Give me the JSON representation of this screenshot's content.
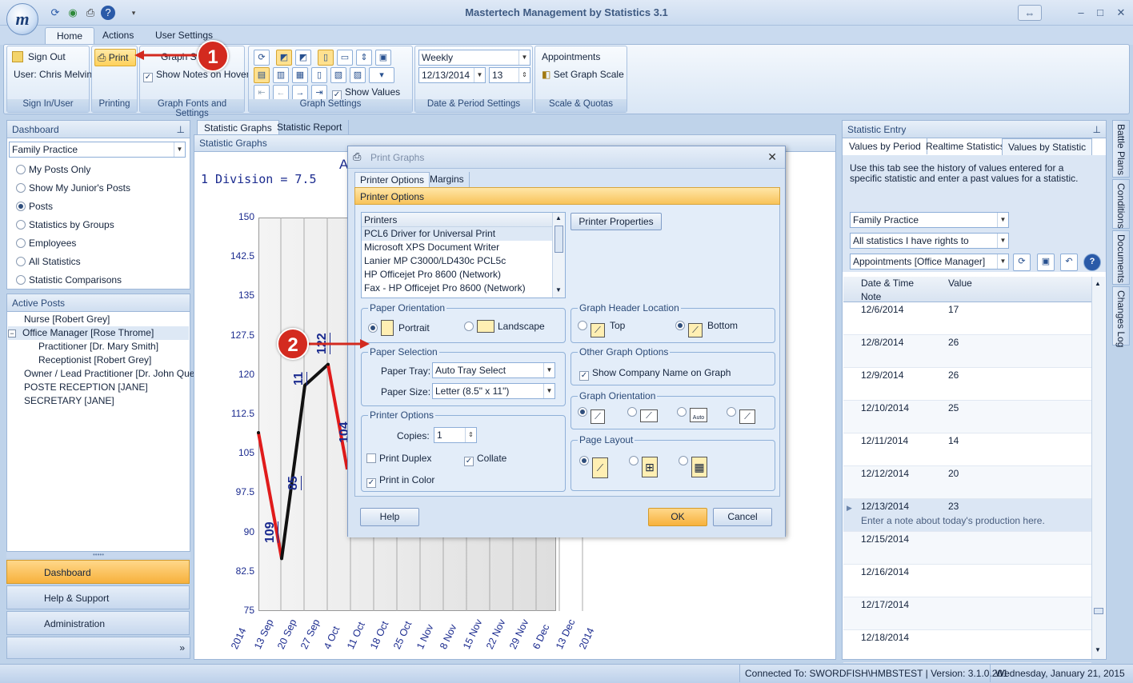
{
  "app": {
    "title": "Mastertech Management by Statistics 3.1",
    "logo": "m"
  },
  "ribbon_tabs": [
    "Home",
    "Actions",
    "User Settings"
  ],
  "ribbon": {
    "signin": {
      "sign_out": "Sign Out",
      "user": "User: Chris Melvin",
      "label": "Sign In/User"
    },
    "printing": {
      "print": "Print",
      "label": "Printing"
    },
    "fonts": {
      "graph_settings": "Graph Se",
      "show_notes": "Show Notes on Hover",
      "label": "Graph Fonts and Settings"
    },
    "graph_settings": {
      "show_values": "Show Values",
      "label": "Graph Settings"
    },
    "date": {
      "period": "Weekly",
      "date": "12/13/2014",
      "count": "13",
      "label": "Date & Period Settings"
    },
    "scale": {
      "appointments": "Appointments",
      "set_scale": "Set Graph Scale",
      "label": "Scale & Quotas"
    }
  },
  "dashboard": {
    "title": "Dashboard",
    "selector": "Family Practice",
    "options": [
      "My Posts Only",
      "Show My Junior's Posts",
      "Posts",
      "Statistics by Groups",
      "Employees",
      "All Statistics",
      "Statistic Comparisons"
    ],
    "selected_option": "Posts",
    "active_posts_title": "Active Posts",
    "posts": [
      "Nurse [Robert Grey]",
      "Office Manager [Rose Throme]",
      "Practitioner  [Dr. Mary Smith]",
      "Receptionist  [Robert Grey]",
      "Owner / Lead Practitioner  [Dr. John Que]",
      "POSTE RECEPTION [JANE]",
      "SECRETARY [JANE]"
    ],
    "nav": [
      "Dashboard",
      "Help & Support",
      "Administration"
    ]
  },
  "center": {
    "tabs": [
      "Statistic Graphs",
      "Statistic Report"
    ],
    "header": "Statistic Graphs",
    "division": "1 Division = 7.5",
    "title_fragment": "A"
  },
  "chart_data": {
    "type": "line",
    "y_ticks": [
      "150",
      "142.5",
      "135",
      "127.5",
      "120",
      "112.5",
      "105",
      "97.5",
      "90",
      "82.5",
      "75"
    ],
    "ylim": [
      75,
      150
    ],
    "x_ticks": [
      "2014",
      "13 Sep",
      "20 Sep",
      "27 Sep",
      "4 Oct",
      "11 Oct",
      "18 Oct",
      "25 Oct",
      "1 Nov",
      "8 Nov",
      "15 Nov",
      "22 Nov",
      "29 Nov",
      "6 Dec",
      "13 Dec",
      "2014"
    ],
    "series": [
      {
        "values": [
          109,
          85,
          118,
          122,
          104
        ]
      }
    ],
    "value_labels": [
      "109",
      "85",
      "11",
      "122",
      "104"
    ]
  },
  "dialog": {
    "title": "Print Graphs",
    "tabs": [
      "Printer Options",
      "Margins"
    ],
    "section": "Printer Options",
    "printers_header": "Printers",
    "printers": [
      "PCL6 Driver for Universal Print",
      "Microsoft XPS Document Writer",
      "Lanier MP C3000/LD430c PCL5c",
      "HP Officejet Pro 8600 (Network)",
      "Fax - HP Officejet Pro 8600 (Network)"
    ],
    "printer_properties": "Printer Properties",
    "orientation": {
      "label": "Paper Orientation",
      "portrait": "Portrait",
      "landscape": "Landscape"
    },
    "header_location": {
      "label": "Graph Header Location",
      "top": "Top",
      "bottom": "Bottom"
    },
    "paper": {
      "label": "Paper Selection",
      "tray_label": "Paper Tray:",
      "tray": "Auto Tray Select",
      "size_label": "Paper Size:",
      "size": "Letter (8.5\" x 11\")"
    },
    "other": {
      "label": "Other Graph Options",
      "company": "Show Company Name on Graph"
    },
    "graph_orientation": {
      "label": "Graph Orientation",
      "auto": "Auto"
    },
    "printer_options": {
      "label": "Printer Options",
      "copies_label": "Copies:",
      "copies": "1",
      "duplex": "Print Duplex",
      "collate": "Collate",
      "color": "Print in Color"
    },
    "page_layout": {
      "label": "Page Layout"
    },
    "help": "Help",
    "ok": "OK",
    "cancel": "Cancel"
  },
  "stat_entry": {
    "title": "Statistic Entry",
    "tabs": [
      "Values by Period",
      "Realtime Statistics",
      "Values by Statistic"
    ],
    "description": "Use this tab see the history of values entered for a specific statistic and enter a past values for a statistic.",
    "group": "Family Practice",
    "filter": "All statistics I have rights to",
    "statistic": "Appointments [Office Manager]",
    "columns": [
      "Date & Time",
      "Value",
      "Note"
    ],
    "rows": [
      {
        "date": "12/6/2014",
        "value": "17"
      },
      {
        "date": "12/8/2014",
        "value": "26"
      },
      {
        "date": "12/9/2014",
        "value": "26"
      },
      {
        "date": "12/10/2014",
        "value": "25"
      },
      {
        "date": "12/11/2014",
        "value": "14"
      },
      {
        "date": "12/12/2014",
        "value": "20"
      },
      {
        "date": "12/13/2014",
        "value": "23"
      },
      {
        "date": "12/15/2014",
        "value": ""
      },
      {
        "date": "12/16/2014",
        "value": ""
      },
      {
        "date": "12/17/2014",
        "value": ""
      },
      {
        "date": "12/18/2014",
        "value": ""
      }
    ],
    "note_placeholder": "Enter a note about today's production here."
  },
  "side_tabs": [
    "Battle Plans",
    "Conditions",
    "Documents",
    "Changes Log"
  ],
  "status": {
    "connection": "Connected To: SWORDFISH\\HMBSTEST | Version: 3.1.0.201",
    "date": "Wednesday, January 21, 2015"
  },
  "callouts": [
    "1",
    "2"
  ],
  "colors": {
    "accent_orange": "#f7b13c",
    "ribbon_blue": "#c9daef",
    "line_red": "#e01b1b",
    "line_black": "#111111",
    "callout_red": "#d32a1f"
  }
}
